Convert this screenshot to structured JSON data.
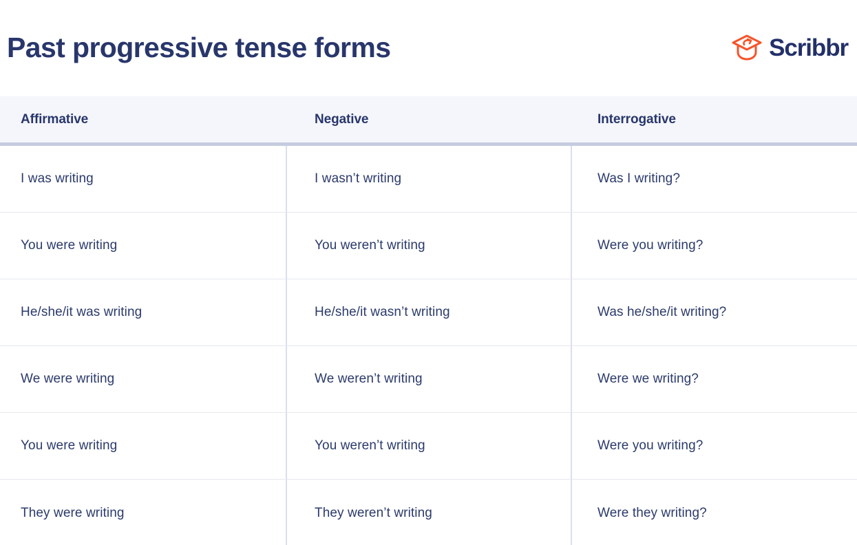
{
  "header": {
    "title": "Past progressive tense forms",
    "brand": {
      "name": "Scribbr",
      "mark_icon": "graduation-cap-icon",
      "mark_color": "#f5542a",
      "word_color": "#23306a"
    }
  },
  "colors": {
    "title": "#28366b",
    "body_text": "#2b3a6b",
    "header_row_bg": "#f5f6fb",
    "header_rule": "#c5ccdf",
    "row_rule": "#e4e7ee",
    "column_rule": "#d9dfee",
    "page_bg": "#ffffff",
    "brand_orange": "#f5542a"
  },
  "table": {
    "columns": [
      "Affirmative",
      "Negative",
      "Interrogative"
    ],
    "rows": [
      [
        "I was writing",
        "I wasn’t writing",
        "Was I writing?"
      ],
      [
        "You were writing",
        "You weren’t writing",
        "Were you writing?"
      ],
      [
        "He/she/it was writing",
        "He/she/it wasn’t writing",
        "Was he/she/it writing?"
      ],
      [
        "We were writing",
        "We weren’t writing",
        "Were we writing?"
      ],
      [
        "You were writing",
        "You weren’t writing",
        "Were you writing?"
      ],
      [
        "They were writing",
        "They weren’t writing",
        "Were they writing?"
      ]
    ]
  }
}
